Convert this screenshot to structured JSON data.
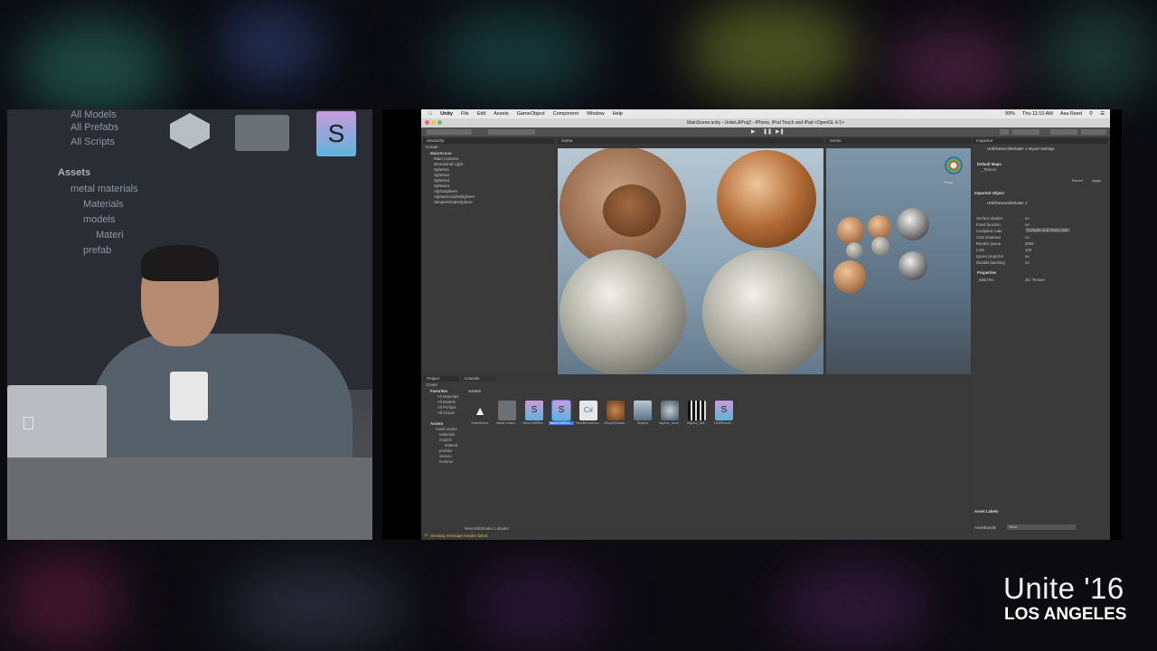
{
  "event": {
    "name": "Unite '16",
    "city": "LOS ANGELES"
  },
  "backdrop": {
    "assets_label": "Assets",
    "labels": [
      "All Models",
      "All Prefabs",
      "All Scripts",
      "metal materials",
      "Materials",
      "models",
      "Materi",
      "prefab"
    ]
  },
  "unity": {
    "menu": {
      "app": "Unity",
      "items": [
        "File",
        "Edit",
        "Assets",
        "GameObject",
        "Component",
        "Window",
        "Help"
      ],
      "clock": "Thu 11:10 AM",
      "user": "Asa Reed",
      "battery": "99%"
    },
    "window_title": "MainScene.unity - UniteLAProj2 - iPhone, iPod Touch and iPad <OpenGL 4.1>",
    "panels": {
      "hierarchy": {
        "title": "Hierarchy",
        "create": "Create",
        "scene": "MainScene",
        "items": [
          "Main Camera",
          "Directional Light",
          "Sphere1",
          "Sphere2",
          "Sphere3",
          "Sphere4",
          "AlphaSphere",
          "AlphaOccludedSphere",
          "SimpleShaderSphere"
        ]
      },
      "game": {
        "title": "Game",
        "aspect": "Free Aspect",
        "scale": "Scale",
        "maximize": "Maximize on Play",
        "mute": "Mute audio",
        "stats": "Stats",
        "gizmos": "Gizmos"
      },
      "scene": {
        "title": "Scene",
        "shaded": "Shaded",
        "mode": "2D",
        "gizmos": "Gizmos",
        "persp": "Persp"
      },
      "inspector": {
        "title": "Inspector",
        "asset": "Unlit/NewUnlitShader 1 Import Settings",
        "default_maps": "Default Maps",
        "texture_row": "_Texture",
        "imported_object": "Imported Object",
        "shader_name": "Unlit/NewUnlitShader 1",
        "fields": [
          {
            "label": "Surface shader",
            "value": "no"
          },
          {
            "label": "Fixed function",
            "value": "no"
          },
          {
            "label": "Compiled code",
            "value": "Compile and show code"
          },
          {
            "label": "Cast shadows",
            "value": "no"
          },
          {
            "label": "Render queue",
            "value": "2000"
          },
          {
            "label": "LOD",
            "value": "100"
          },
          {
            "label": "Ignore projector",
            "value": "no"
          },
          {
            "label": "Disable batching",
            "value": "no"
          }
        ],
        "properties": "Properties",
        "main_tex_label": "_MainTex",
        "main_tex_value": "2D: Texture",
        "asset_labels": "Asset Labels",
        "asset_bundle": "AssetBundle",
        "bundle_value": "None",
        "revert": "Revert",
        "apply": "Apply"
      },
      "project": {
        "title": "Project",
        "console": "Console",
        "create": "Create",
        "favorites": "Favorites",
        "favorites_items": [
          "All Materials",
          "All Models",
          "All Prefabs",
          "All Scripts"
        ],
        "assets": "Assets",
        "assets_items": [
          "metal materi",
          "Materials",
          "models",
          "Materia",
          "prefabs",
          "scenes",
          "textures"
        ],
        "breadcrumb": "Assets",
        "asset_tiles": [
          "MainScene",
          "metal materi...",
          "NewUnlitSha...",
          "NewUnlitSha...",
          "NewBehaviour...",
          "SimpleShade...",
          "Skybox",
          "skybox_sect...",
          "skybox_dot...",
          "UnlitShade..."
        ],
        "selected_file": "NewUnlitShader 1.shader"
      },
      "status": "Sending message header failed"
    }
  }
}
